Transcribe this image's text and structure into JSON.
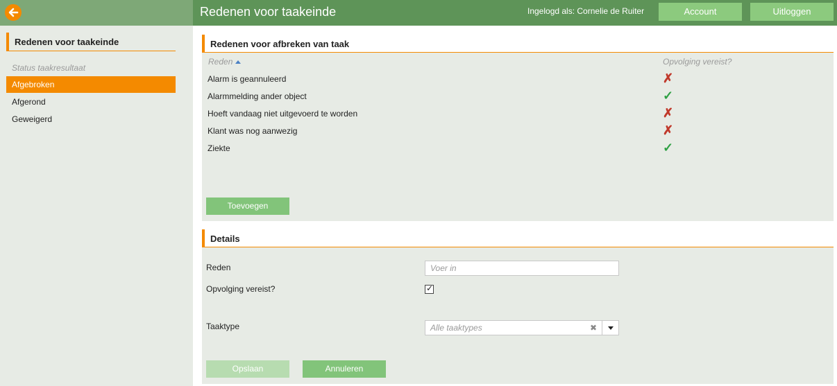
{
  "header": {
    "title": "Redenen voor taakeinde",
    "user_label": "Ingelogd als: Cornelie de Ruiter",
    "account_label": "Account",
    "logout_label": "Uitloggen",
    "accent_color": "#f48a00",
    "brand_color": "#5e9458"
  },
  "sidebar": {
    "header": "Redenen voor taakeinde",
    "subheading": "Status taakresultaat",
    "items": [
      {
        "label": "Afgebroken",
        "active": true
      },
      {
        "label": "Afgerond",
        "active": false
      },
      {
        "label": "Geweigerd",
        "active": false
      }
    ]
  },
  "reasons": {
    "header": "Redenen voor afbreken van taak",
    "col_reason": "Reden",
    "col_followup": "Opvolging vereist?",
    "rows": [
      {
        "label": "Alarm is geannuleerd",
        "followup": "✗",
        "followup_icon": "cross-icon"
      },
      {
        "label": "Alarmmelding ander object",
        "followup": "✓",
        "followup_icon": "check-icon"
      },
      {
        "label": "Hoeft vandaag niet uitgevoerd te worden",
        "followup": "✗",
        "followup_icon": "cross-icon"
      },
      {
        "label": "Klant was nog aanwezig",
        "followup": "✗",
        "followup_icon": "cross-icon"
      },
      {
        "label": "Ziekte",
        "followup": "✓",
        "followup_icon": "check-icon"
      }
    ],
    "add_label": "Toevoegen"
  },
  "details": {
    "header": "Details",
    "reason_label": "Reden",
    "reason_placeholder": "Voer in",
    "followup_label": "Opvolging vereist?",
    "followup_checked": "✓",
    "tasktype_label": "Taaktype",
    "tasktype_value": "Alle taaktypes",
    "clear_glyph": "✖",
    "save_label": "Opslaan",
    "cancel_label": "Annuleren"
  }
}
